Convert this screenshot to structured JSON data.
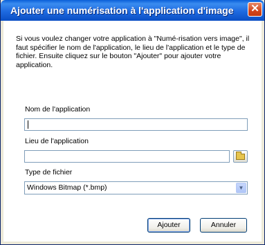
{
  "window": {
    "title": "Ajouter une numérisation à l'application d'image",
    "close_label": "✕"
  },
  "dialog": {
    "description": "Si vous voulez changer votre application à \"Numé-risation vers image\", il faut spécifier le nom de l'application, le lieu de l'application et le type de fichier. Ensuite cliquez sur le bouton \"Ajouter\" pour ajouter votre application.",
    "app_name_label": "Nom de l'application",
    "app_name_value": "",
    "app_location_label": "Lieu de l'application",
    "app_location_value": "",
    "file_type_label": "Type de fichier",
    "file_type_value": "Windows Bitmap (*.bmp)",
    "add_button": "Ajouter",
    "cancel_button": "Annuler"
  },
  "icons": {
    "browse": "folder-icon",
    "dropdown": "chevron-down-icon",
    "close": "close-icon"
  },
  "colors": {
    "titlebar": "#0a5fd8",
    "close": "#d2461c",
    "face": "#ece9d8",
    "field_border": "#7f9db9"
  }
}
